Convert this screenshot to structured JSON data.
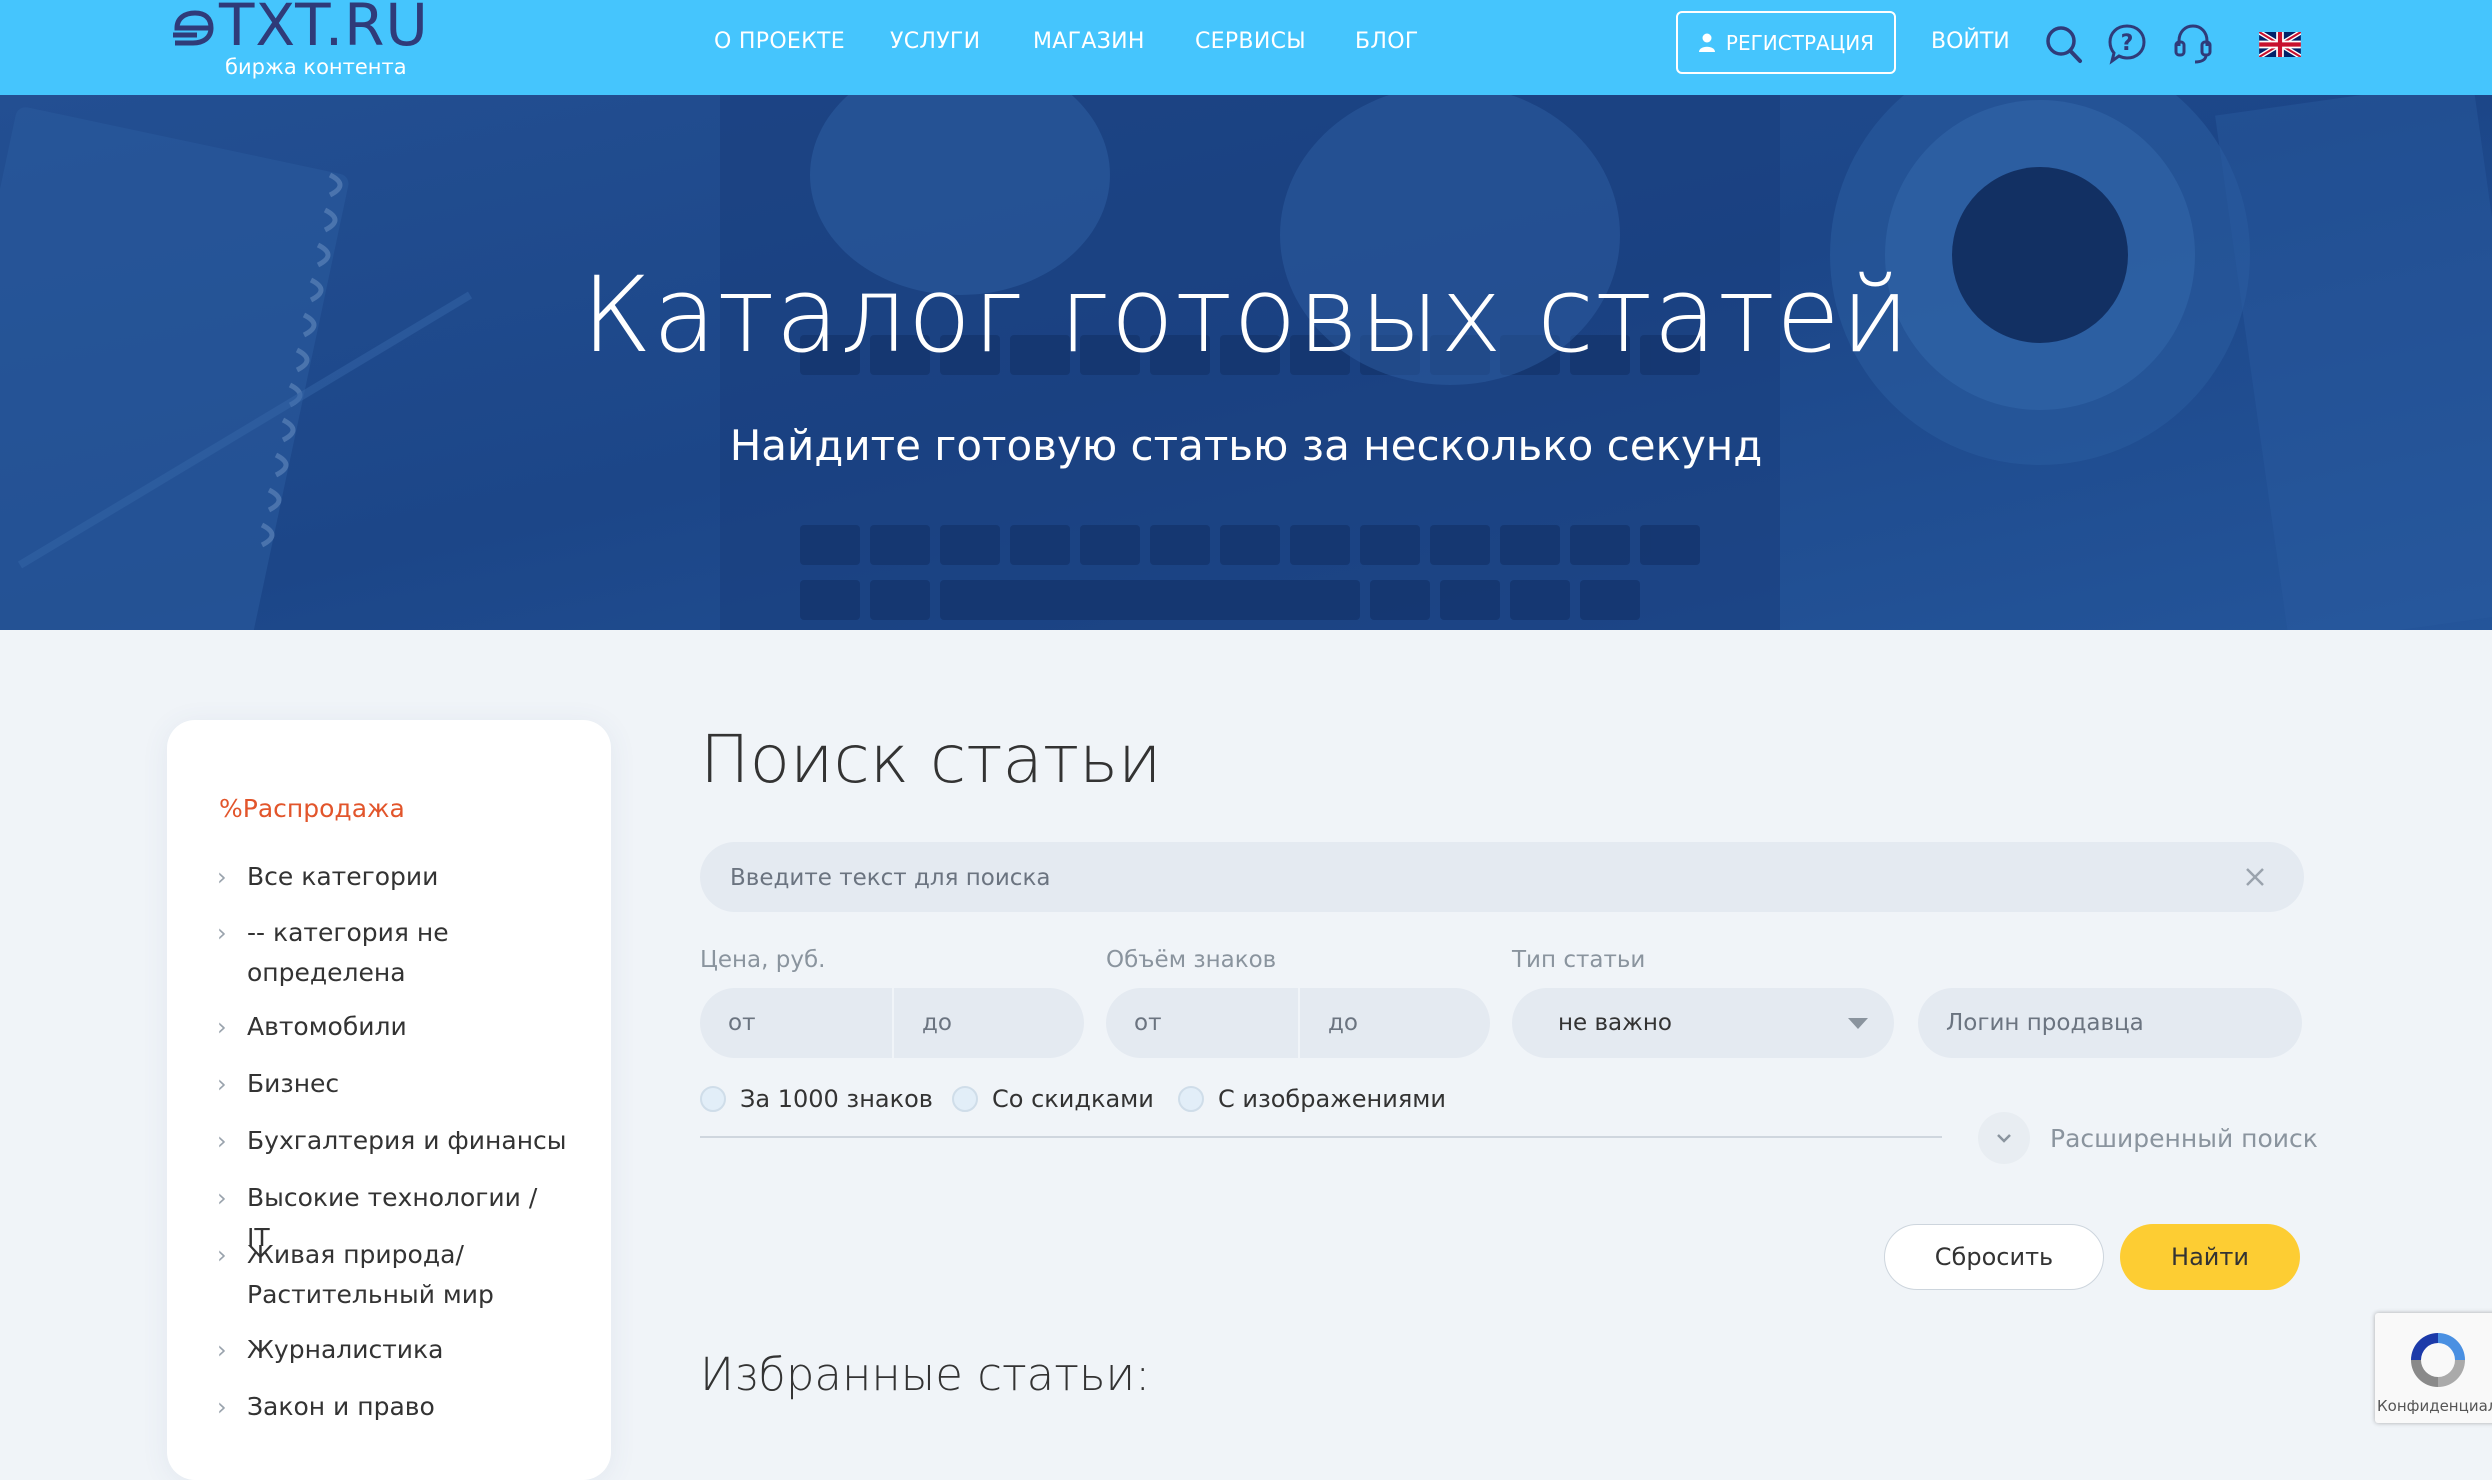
{
  "brand": {
    "logo_text": "TXT.RU",
    "tagline": "биржа контента",
    "colors": {
      "header_bg": "#45c5fd",
      "accent_yellow": "#fdcd33",
      "sale_red": "#e2552b",
      "logo_navy": "#2f3b79"
    }
  },
  "nav": {
    "items": [
      "О ПРОЕКТЕ",
      "УСЛУГИ",
      "МАГАЗИН",
      "СЕРВИСЫ",
      "БЛОГ"
    ],
    "register_label": "РЕГИСТРАЦИЯ",
    "login_label": "ВОЙТИ",
    "icons": [
      "search-icon",
      "help-icon",
      "support-headset-icon",
      "uk-flag-icon"
    ]
  },
  "hero": {
    "title": "Каталог готовых статей",
    "subtitle": "Найдите готовую статью за несколько секунд"
  },
  "sidebar": {
    "sale_label": "Распродажа",
    "sale_icon": "%",
    "items": [
      "Все категории",
      "-- категория не определена",
      "Автомобили",
      "Бизнес",
      "Бухгалтерия и финансы",
      "Высокие технологии / IT",
      "Живая природа/ Растительный мир",
      "Журналистика",
      "Закон и право"
    ]
  },
  "search": {
    "title": "Поиск статьи",
    "placeholder": "Введите текст для поиска",
    "price_label": "Цена, руб.",
    "volume_label": "Объём знаков",
    "type_label": "Тип статьи",
    "from_placeholder": "от",
    "to_placeholder": "до",
    "type_value": "не важно",
    "seller_placeholder": "Логин продавца",
    "checkboxes": [
      "За 1000 знаков",
      "Со скидками",
      "С изображениями"
    ],
    "advanced_label": "Расширенный поиск",
    "reset_label": "Сбросить",
    "find_label": "Найти"
  },
  "favorites": {
    "title": "Избранные статьи:"
  },
  "recaptcha": {
    "label": "Конфиденциал"
  }
}
